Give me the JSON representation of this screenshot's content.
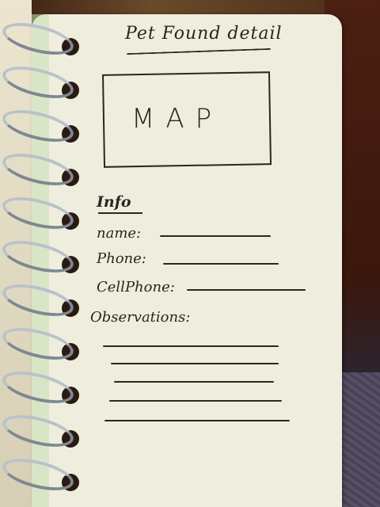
{
  "sketch": {
    "title": "Pet Found detail",
    "map_placeholder": "MAP",
    "info_heading": "Info",
    "fields": {
      "name_label": "name:",
      "phone_label": "Phone:",
      "cellphone_label": "CellPhone:",
      "observations_label": "Observations:"
    }
  },
  "colors": {
    "paper": "#efeede",
    "ink": "#2a2624",
    "ring": "#9aa4ad",
    "background": "#4a2e1f"
  }
}
